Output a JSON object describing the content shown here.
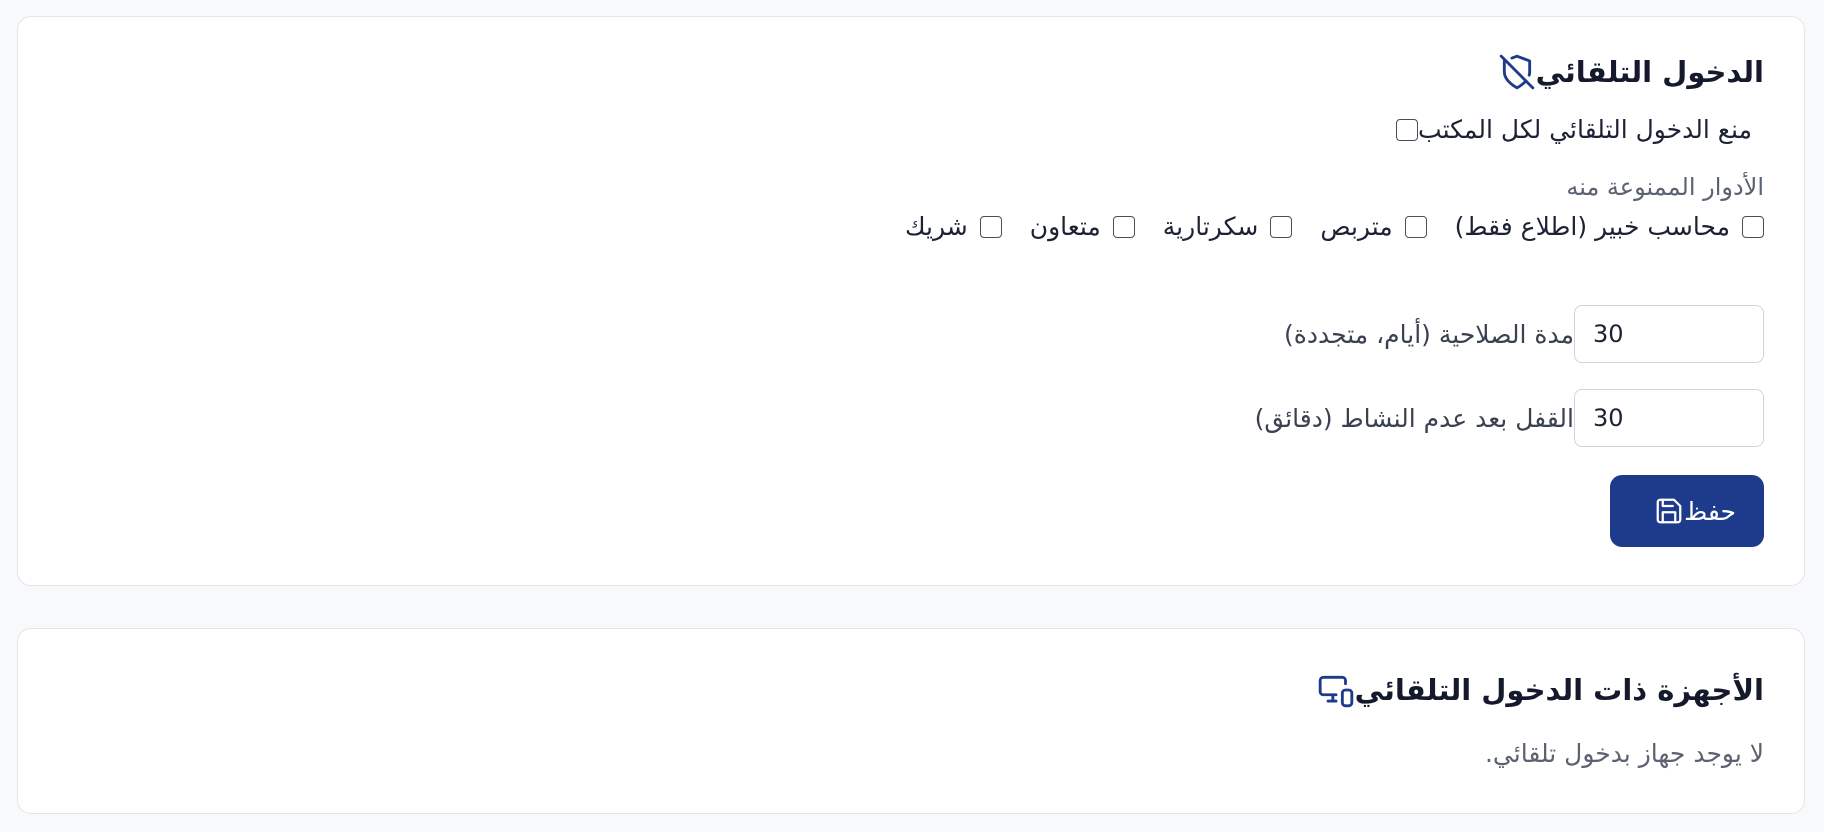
{
  "colors": {
    "primary": "#1e3a8a",
    "card_bg": "#ffffff",
    "page_bg": "#f8f9fb"
  },
  "auto_login": {
    "title": "الدخول التلقائي",
    "icon": "shield-off-icon",
    "block_all_label": "منع الدخول التلقائي لكل المكتب",
    "blocked_roles_label": "الأدوار الممنوعة منه",
    "roles": [
      {
        "label": "شريك",
        "checked": false
      },
      {
        "label": "متعاون",
        "checked": false
      },
      {
        "label": "سكرتارية",
        "checked": false
      },
      {
        "label": "متربص",
        "checked": false
      },
      {
        "label": "محاسب خبير (اطلاع فقط)",
        "checked": false
      }
    ],
    "validity_label": "مدة الصلاحية (أيام، متجددة)",
    "validity_value": "30",
    "lock_label": "القفل بعد عدم النشاط (دقائق)",
    "lock_value": "30",
    "save_label": "حفظ",
    "save_icon": "save-icon"
  },
  "devices": {
    "title": "الأجهزة ذات الدخول التلقائي",
    "icon": "devices-icon",
    "empty_text": "لا يوجد جهاز بدخول تلقائي."
  }
}
